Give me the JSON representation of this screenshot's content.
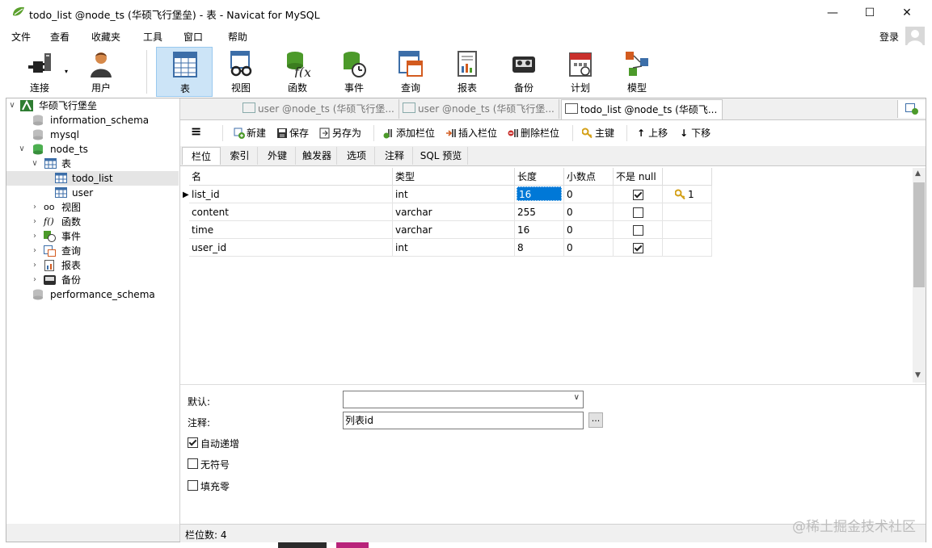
{
  "window": {
    "title": "todo_list @node_ts (华硕飞行堡垒) - 表 - Navicat for MySQL",
    "minimize": "—",
    "maximize": "☐",
    "close": "✕"
  },
  "menu": {
    "items": [
      "文件",
      "查看",
      "收藏夹",
      "工具",
      "窗口",
      "帮助"
    ],
    "login": "登录"
  },
  "toolbar": {
    "buttons": [
      {
        "label": "连接",
        "icon": "plug-icon"
      },
      {
        "label": "用户",
        "icon": "user-icon"
      },
      {
        "label": "表",
        "icon": "table-icon"
      },
      {
        "label": "视图",
        "icon": "view-glasses-icon"
      },
      {
        "label": "函数",
        "icon": "function-icon"
      },
      {
        "label": "事件",
        "icon": "event-clock-icon"
      },
      {
        "label": "查询",
        "icon": "query-icon"
      },
      {
        "label": "报表",
        "icon": "report-icon"
      },
      {
        "label": "备份",
        "icon": "backup-icon"
      },
      {
        "label": "计划",
        "icon": "calendar-icon"
      },
      {
        "label": "模型",
        "icon": "model-icon"
      }
    ]
  },
  "tree": {
    "connection": "华硕飞行堡垒",
    "databases": [
      "information_schema",
      "mysql",
      "node_ts",
      "performance_schema"
    ],
    "tables_group": "表",
    "tables": [
      "todo_list",
      "user"
    ],
    "groups": [
      "视图",
      "函数",
      "事件",
      "查询",
      "报表",
      "备份"
    ]
  },
  "tabs": [
    "user @node_ts (华硕飞行堡...",
    "user @node_ts (华硕飞行堡...",
    "todo_list @node_ts (华硕飞..."
  ],
  "editor_toolbar": {
    "menu_icon": "≡",
    "new": "新建",
    "save": "保存",
    "save_as": "另存为",
    "add_column": "添加栏位",
    "insert_column": "插入栏位",
    "delete_column": "删除栏位",
    "primary_key": "主键",
    "move_up": "上移",
    "move_down": "下移"
  },
  "subtabs": [
    "栏位",
    "索引",
    "外键",
    "触发器",
    "选项",
    "注释",
    "SQL 预览"
  ],
  "grid": {
    "headers": [
      "名",
      "类型",
      "长度",
      "小数点",
      "不是 null",
      ""
    ],
    "rows": [
      {
        "name": "list_id",
        "type": "int",
        "length": "16",
        "decimals": "0",
        "not_null": true,
        "key": "1"
      },
      {
        "name": "content",
        "type": "varchar",
        "length": "255",
        "decimals": "0",
        "not_null": false,
        "key": ""
      },
      {
        "name": "time",
        "type": "varchar",
        "length": "16",
        "decimals": "0",
        "not_null": false,
        "key": ""
      },
      {
        "name": "user_id",
        "type": "int",
        "length": "8",
        "decimals": "0",
        "not_null": true,
        "key": ""
      }
    ]
  },
  "properties": {
    "default_label": "默认:",
    "default_value": "",
    "comment_label": "注释:",
    "comment_value": "列表id",
    "comment_btn": "...",
    "auto_increment": "自动递增",
    "auto_increment_checked": true,
    "unsigned": "无符号",
    "unsigned_checked": false,
    "zerofill": "填充零",
    "zerofill_checked": false
  },
  "status": {
    "column_count": "栏位数: 4"
  },
  "watermark": "@稀土掘金技术社区",
  "colors": {
    "accent": "#0078d7",
    "active_tool": "#cce4f7",
    "key_gold": "#d4a017"
  }
}
